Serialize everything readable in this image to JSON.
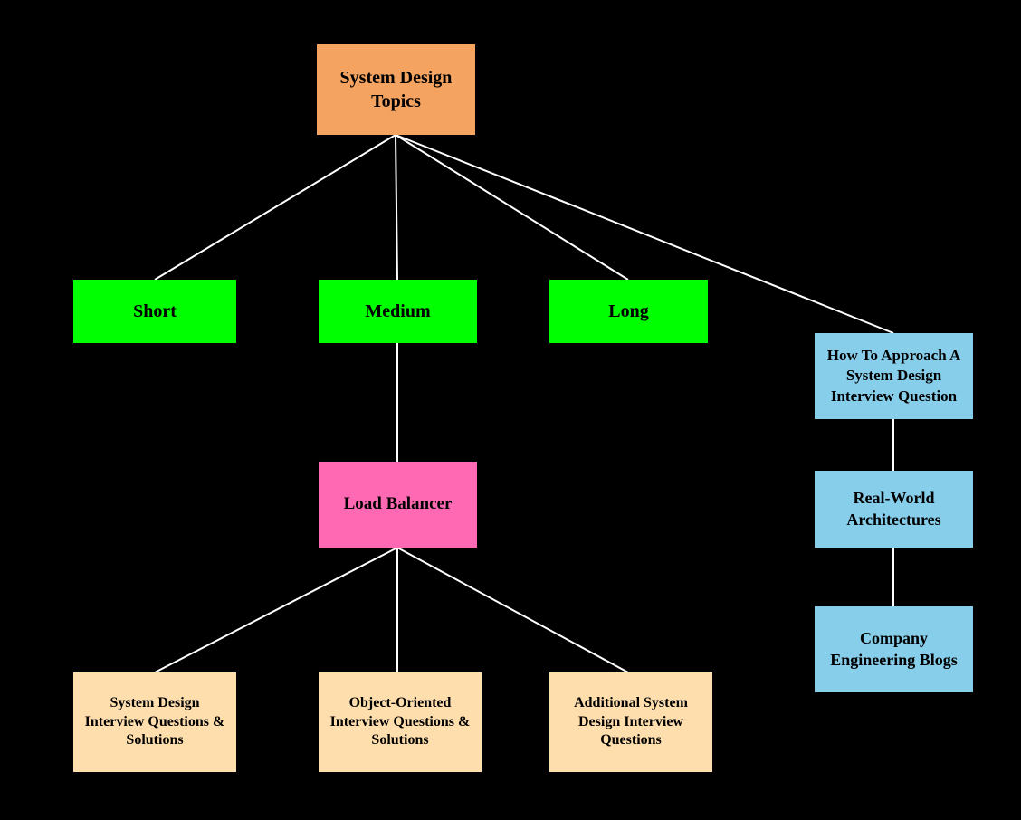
{
  "nodes": {
    "root": {
      "label": "System Design Topics"
    },
    "short": {
      "label": "Short"
    },
    "medium": {
      "label": "Medium"
    },
    "long": {
      "label": "Long"
    },
    "load_balancer": {
      "label": "Load Balancer"
    },
    "how_to_approach": {
      "label": "How To Approach A System Design Interview Question"
    },
    "real_world": {
      "label": "Real-World Architectures"
    },
    "company_engineering": {
      "label": "Company Engineering Blogs"
    },
    "sd_interview_qs": {
      "label": "System Design Interview Questions & Solutions"
    },
    "oo_interview_qs": {
      "label": "Object-Oriented Interview Questions & Solutions"
    },
    "additional_sd": {
      "label": "Additional System Design Interview Questions"
    }
  }
}
